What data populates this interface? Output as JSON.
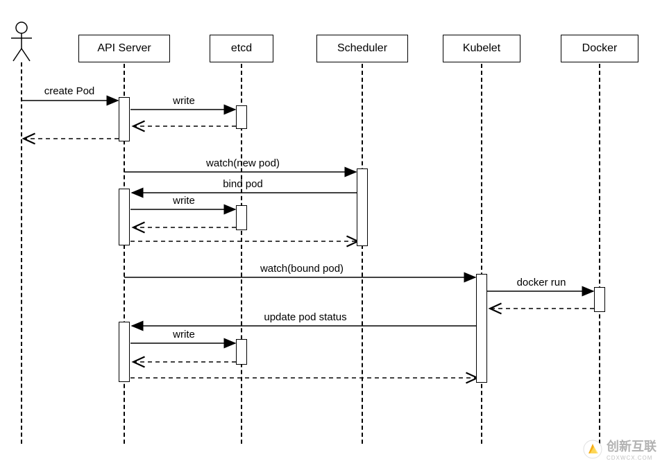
{
  "participants": {
    "api_server": "API Server",
    "etcd": "etcd",
    "scheduler": "Scheduler",
    "kubelet": "Kubelet",
    "docker": "Docker"
  },
  "messages": {
    "create_pod": "create Pod",
    "write1": "write",
    "watch_new": "watch(new pod)",
    "bind_pod": "bind pod",
    "write2": "write",
    "watch_bound": "watch(bound pod)",
    "docker_run": "docker run",
    "update_status": "update pod status",
    "write3": "write"
  },
  "watermark": {
    "text": "创新互联",
    "sub": "CDXWCX.COM"
  },
  "chart_data": {
    "type": "sequence_diagram",
    "actor": "User",
    "participants": [
      "API Server",
      "etcd",
      "Scheduler",
      "Kubelet",
      "Docker"
    ],
    "interactions": [
      {
        "from": "User",
        "to": "API Server",
        "label": "create Pod",
        "type": "sync"
      },
      {
        "from": "API Server",
        "to": "etcd",
        "label": "write",
        "type": "sync"
      },
      {
        "from": "etcd",
        "to": "API Server",
        "label": "",
        "type": "return"
      },
      {
        "from": "API Server",
        "to": "User",
        "label": "",
        "type": "return"
      },
      {
        "from": "API Server",
        "to": "Scheduler",
        "label": "watch(new pod)",
        "type": "sync"
      },
      {
        "from": "Scheduler",
        "to": "API Server",
        "label": "bind pod",
        "type": "sync"
      },
      {
        "from": "API Server",
        "to": "etcd",
        "label": "write",
        "type": "sync"
      },
      {
        "from": "etcd",
        "to": "API Server",
        "label": "",
        "type": "return"
      },
      {
        "from": "API Server",
        "to": "Scheduler",
        "label": "",
        "type": "return"
      },
      {
        "from": "API Server",
        "to": "Kubelet",
        "label": "watch(bound pod)",
        "type": "sync"
      },
      {
        "from": "Kubelet",
        "to": "Docker",
        "label": "docker run",
        "type": "sync"
      },
      {
        "from": "Docker",
        "to": "Kubelet",
        "label": "",
        "type": "return"
      },
      {
        "from": "Kubelet",
        "to": "API Server",
        "label": "update pod status",
        "type": "sync"
      },
      {
        "from": "API Server",
        "to": "etcd",
        "label": "write",
        "type": "sync"
      },
      {
        "from": "etcd",
        "to": "API Server",
        "label": "",
        "type": "return"
      },
      {
        "from": "API Server",
        "to": "Kubelet",
        "label": "",
        "type": "return"
      }
    ]
  }
}
